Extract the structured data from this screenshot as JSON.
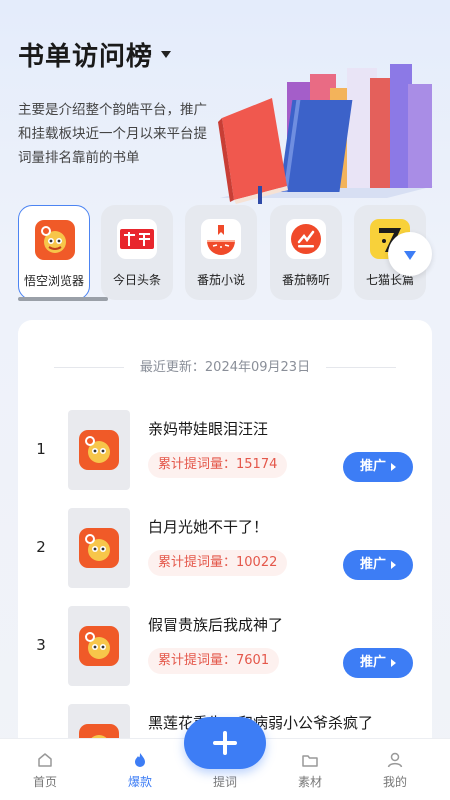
{
  "header": {
    "title": "书单访问榜",
    "description": "主要是介绍整个韵皓平台，推广和挂载板块近一个月以来平台提词量排名靠前的书单"
  },
  "apps": [
    {
      "label": "悟空浏览器",
      "icon": "wukong-browser-icon",
      "selected": true
    },
    {
      "label": "今日头条",
      "icon": "toutiao-icon",
      "selected": false
    },
    {
      "label": "番茄小说",
      "icon": "fanqie-novel-icon",
      "selected": false
    },
    {
      "label": "番茄畅听",
      "icon": "fanqie-listen-icon",
      "selected": false
    },
    {
      "label": "七猫长篇",
      "icon": "qimao-icon",
      "selected": false
    }
  ],
  "list": {
    "update_label": "最近更新：2024年09月23日",
    "promote_label": "推广",
    "items": [
      {
        "rank": "1",
        "name": "亲妈带娃眼泪汪汪",
        "count": "累计提词量：15174"
      },
      {
        "rank": "2",
        "name": "白月光她不干了！",
        "count": "累计提词量：10022"
      },
      {
        "rank": "3",
        "name": "假冒贵族后我成神了",
        "count": "累计提词量：7601"
      },
      {
        "rank": "",
        "name": "黑莲花重生，和病弱小公爷杀疯了",
        "count": ""
      }
    ]
  },
  "nav": [
    {
      "label": "首页",
      "icon": "home-icon",
      "active": false
    },
    {
      "label": "爆款",
      "icon": "flame-icon",
      "active": true
    },
    {
      "label": "提词",
      "icon": "plus-icon",
      "active": false
    },
    {
      "label": "素材",
      "icon": "folder-icon",
      "active": false
    },
    {
      "label": "我的",
      "icon": "user-icon",
      "active": false
    }
  ],
  "colors": {
    "accent": "#3d7df5",
    "count_text": "#e4574a",
    "count_bg": "#fdf1ef"
  }
}
